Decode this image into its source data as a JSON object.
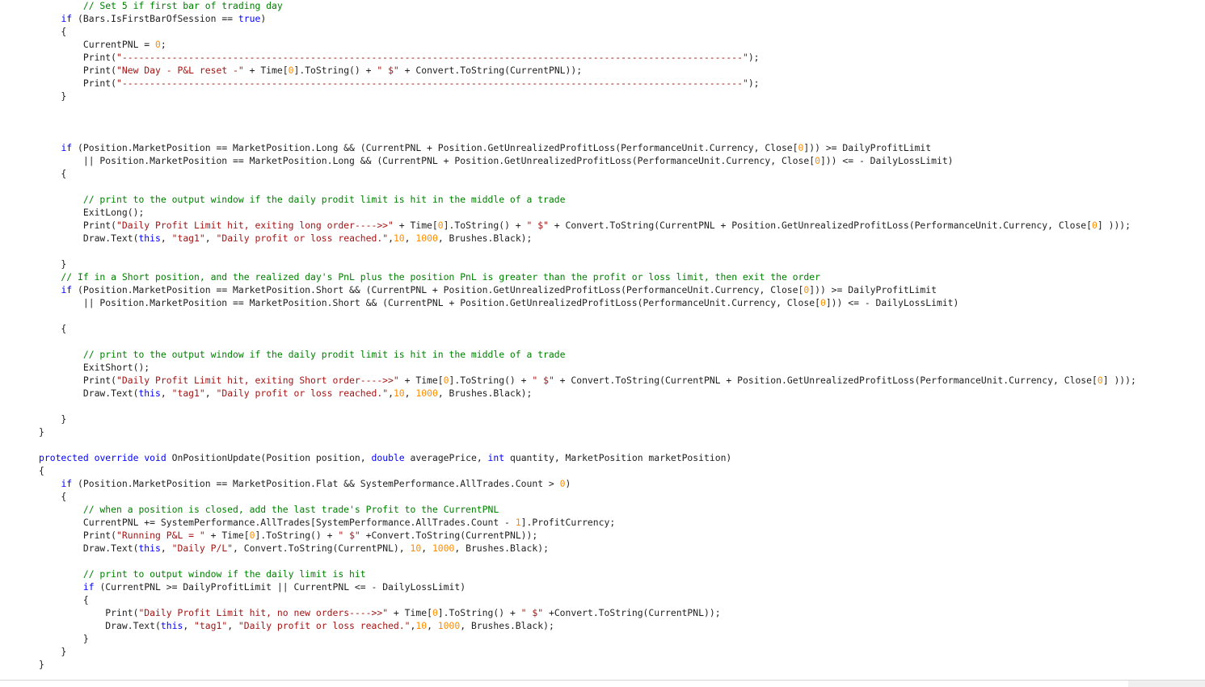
{
  "colors": {
    "background": "#ffffff",
    "text": "#1e1e1e",
    "keyword": "#0000ff",
    "string": "#a31515",
    "number": "#ff8c00",
    "comment": "#008000"
  },
  "lines": [
    [
      {
        "t": "com",
        "v": "        // Set 5 if first bar of trading day"
      }
    ],
    [
      {
        "t": "txt",
        "v": "    "
      },
      {
        "t": "kw",
        "v": "if"
      },
      {
        "t": "txt",
        "v": " (Bars.IsFirstBarOfSession == "
      },
      {
        "t": "kw",
        "v": "true"
      },
      {
        "t": "txt",
        "v": ")"
      }
    ],
    [
      {
        "t": "txt",
        "v": "    {"
      }
    ],
    [
      {
        "t": "txt",
        "v": "        CurrentPNL = "
      },
      {
        "t": "num",
        "v": "0"
      },
      {
        "t": "txt",
        "v": ";"
      }
    ],
    [
      {
        "t": "txt",
        "v": "        Print("
      },
      {
        "t": "str",
        "v": "\"----------------------------------------------------------------------------------------------------------------\""
      },
      {
        "t": "txt",
        "v": ");"
      }
    ],
    [
      {
        "t": "txt",
        "v": "        Print("
      },
      {
        "t": "str",
        "v": "\"New Day - P&L reset -\""
      },
      {
        "t": "txt",
        "v": " + Time["
      },
      {
        "t": "num",
        "v": "0"
      },
      {
        "t": "txt",
        "v": "].ToString() + "
      },
      {
        "t": "str",
        "v": "\" $\""
      },
      {
        "t": "txt",
        "v": " + Convert.ToString(CurrentPNL));"
      }
    ],
    [
      {
        "t": "txt",
        "v": "        Print("
      },
      {
        "t": "str",
        "v": "\"----------------------------------------------------------------------------------------------------------------\""
      },
      {
        "t": "txt",
        "v": ");"
      }
    ],
    [
      {
        "t": "txt",
        "v": "    }"
      }
    ],
    [],
    [],
    [],
    [
      {
        "t": "txt",
        "v": "    "
      },
      {
        "t": "kw",
        "v": "if"
      },
      {
        "t": "txt",
        "v": " (Position.MarketPosition == MarketPosition.Long && (CurrentPNL + Position.GetUnrealizedProfitLoss(PerformanceUnit.Currency, Close["
      },
      {
        "t": "num",
        "v": "0"
      },
      {
        "t": "txt",
        "v": "])) >= DailyProfitLimit"
      }
    ],
    [
      {
        "t": "txt",
        "v": "        || Position.MarketPosition == MarketPosition.Long && (CurrentPNL + Position.GetUnrealizedProfitLoss(PerformanceUnit.Currency, Close["
      },
      {
        "t": "num",
        "v": "0"
      },
      {
        "t": "txt",
        "v": "])) <= - DailyLossLimit)"
      }
    ],
    [
      {
        "t": "txt",
        "v": "    {"
      }
    ],
    [],
    [
      {
        "t": "com",
        "v": "        // print to the output window if the daily prodit limit is hit in the middle of a trade"
      }
    ],
    [
      {
        "t": "txt",
        "v": "        ExitLong();"
      }
    ],
    [
      {
        "t": "txt",
        "v": "        Print("
      },
      {
        "t": "str",
        "v": "\"Daily Profit Limit hit, exiting long order---->>\""
      },
      {
        "t": "txt",
        "v": " + Time["
      },
      {
        "t": "num",
        "v": "0"
      },
      {
        "t": "txt",
        "v": "].ToString() + "
      },
      {
        "t": "str",
        "v": "\" $\""
      },
      {
        "t": "txt",
        "v": " + Convert.ToString(CurrentPNL + Position.GetUnrealizedProfitLoss(PerformanceUnit.Currency, Close["
      },
      {
        "t": "num",
        "v": "0"
      },
      {
        "t": "txt",
        "v": "] )));"
      }
    ],
    [
      {
        "t": "txt",
        "v": "        Draw.Text("
      },
      {
        "t": "kw",
        "v": "this"
      },
      {
        "t": "txt",
        "v": ", "
      },
      {
        "t": "str",
        "v": "\"tag1\""
      },
      {
        "t": "txt",
        "v": ", "
      },
      {
        "t": "str",
        "v": "\"Daily profit or loss reached.\""
      },
      {
        "t": "txt",
        "v": ","
      },
      {
        "t": "num",
        "v": "10"
      },
      {
        "t": "txt",
        "v": ", "
      },
      {
        "t": "num",
        "v": "1000"
      },
      {
        "t": "txt",
        "v": ", Brushes.Black);"
      }
    ],
    [],
    [
      {
        "t": "txt",
        "v": "    }"
      }
    ],
    [
      {
        "t": "com",
        "v": "    // If in a Short position, and the realized day's PnL plus the position PnL is greater than the profit or loss limit, then exit the order"
      }
    ],
    [
      {
        "t": "txt",
        "v": "    "
      },
      {
        "t": "kw",
        "v": "if"
      },
      {
        "t": "txt",
        "v": " (Position.MarketPosition == MarketPosition.Short && (CurrentPNL + Position.GetUnrealizedProfitLoss(PerformanceUnit.Currency, Close["
      },
      {
        "t": "num",
        "v": "0"
      },
      {
        "t": "txt",
        "v": "])) >= DailyProfitLimit"
      }
    ],
    [
      {
        "t": "txt",
        "v": "        || Position.MarketPosition == MarketPosition.Short && (CurrentPNL + Position.GetUnrealizedProfitLoss(PerformanceUnit.Currency, Close["
      },
      {
        "t": "num",
        "v": "0"
      },
      {
        "t": "txt",
        "v": "])) <= - DailyLossLimit)"
      }
    ],
    [],
    [
      {
        "t": "txt",
        "v": "    {"
      }
    ],
    [],
    [
      {
        "t": "com",
        "v": "        // print to the output window if the daily prodit limit is hit in the middle of a trade"
      }
    ],
    [
      {
        "t": "txt",
        "v": "        ExitShort();"
      }
    ],
    [
      {
        "t": "txt",
        "v": "        Print("
      },
      {
        "t": "str",
        "v": "\"Daily Profit Limit hit, exiting Short order---->>\""
      },
      {
        "t": "txt",
        "v": " + Time["
      },
      {
        "t": "num",
        "v": "0"
      },
      {
        "t": "txt",
        "v": "].ToString() + "
      },
      {
        "t": "str",
        "v": "\" $\""
      },
      {
        "t": "txt",
        "v": " + Convert.ToString(CurrentPNL + Position.GetUnrealizedProfitLoss(PerformanceUnit.Currency, Close["
      },
      {
        "t": "num",
        "v": "0"
      },
      {
        "t": "txt",
        "v": "] )));"
      }
    ],
    [
      {
        "t": "txt",
        "v": "        Draw.Text("
      },
      {
        "t": "kw",
        "v": "this"
      },
      {
        "t": "txt",
        "v": ", "
      },
      {
        "t": "str",
        "v": "\"tag1\""
      },
      {
        "t": "txt",
        "v": ", "
      },
      {
        "t": "str",
        "v": "\"Daily profit or loss reached.\""
      },
      {
        "t": "txt",
        "v": ","
      },
      {
        "t": "num",
        "v": "10"
      },
      {
        "t": "txt",
        "v": ", "
      },
      {
        "t": "num",
        "v": "1000"
      },
      {
        "t": "txt",
        "v": ", Brushes.Black);"
      }
    ],
    [],
    [
      {
        "t": "txt",
        "v": "    }"
      }
    ],
    [
      {
        "t": "txt",
        "v": "}"
      }
    ],
    [],
    [
      {
        "t": "kw",
        "v": "protected"
      },
      {
        "t": "txt",
        "v": " "
      },
      {
        "t": "kw",
        "v": "override"
      },
      {
        "t": "txt",
        "v": " "
      },
      {
        "t": "kw",
        "v": "void"
      },
      {
        "t": "txt",
        "v": " OnPositionUpdate(Position position, "
      },
      {
        "t": "kw",
        "v": "double"
      },
      {
        "t": "txt",
        "v": " averagePrice, "
      },
      {
        "t": "kw",
        "v": "int"
      },
      {
        "t": "txt",
        "v": " quantity, MarketPosition marketPosition)"
      }
    ],
    [
      {
        "t": "txt",
        "v": "{"
      }
    ],
    [
      {
        "t": "txt",
        "v": "    "
      },
      {
        "t": "kw",
        "v": "if"
      },
      {
        "t": "txt",
        "v": " (Position.MarketPosition == MarketPosition.Flat && SystemPerformance.AllTrades.Count > "
      },
      {
        "t": "num",
        "v": "0"
      },
      {
        "t": "txt",
        "v": ")"
      }
    ],
    [
      {
        "t": "txt",
        "v": "    {"
      }
    ],
    [
      {
        "t": "com",
        "v": "        // when a position is closed, add the last trade's Profit to the CurrentPNL"
      }
    ],
    [
      {
        "t": "txt",
        "v": "        CurrentPNL += SystemPerformance.AllTrades[SystemPerformance.AllTrades.Count - "
      },
      {
        "t": "num",
        "v": "1"
      },
      {
        "t": "txt",
        "v": "].ProfitCurrency;"
      }
    ],
    [
      {
        "t": "txt",
        "v": "        Print("
      },
      {
        "t": "str",
        "v": "\"Running P&L = \""
      },
      {
        "t": "txt",
        "v": " + Time["
      },
      {
        "t": "num",
        "v": "0"
      },
      {
        "t": "txt",
        "v": "].ToString() + "
      },
      {
        "t": "str",
        "v": "\" $\""
      },
      {
        "t": "txt",
        "v": " +Convert.ToString(CurrentPNL));"
      }
    ],
    [
      {
        "t": "txt",
        "v": "        Draw.Text("
      },
      {
        "t": "kw",
        "v": "this"
      },
      {
        "t": "txt",
        "v": ", "
      },
      {
        "t": "str",
        "v": "\"Daily P/L\""
      },
      {
        "t": "txt",
        "v": ", Convert.ToString(CurrentPNL), "
      },
      {
        "t": "num",
        "v": "10"
      },
      {
        "t": "txt",
        "v": ", "
      },
      {
        "t": "num",
        "v": "1000"
      },
      {
        "t": "txt",
        "v": ", Brushes.Black);"
      }
    ],
    [],
    [
      {
        "t": "com",
        "v": "        // print to output window if the daily limit is hit"
      }
    ],
    [
      {
        "t": "txt",
        "v": "        "
      },
      {
        "t": "kw",
        "v": "if"
      },
      {
        "t": "txt",
        "v": " (CurrentPNL >= DailyProfitLimit || CurrentPNL <= - DailyLossLimit)"
      }
    ],
    [
      {
        "t": "txt",
        "v": "        {"
      }
    ],
    [
      {
        "t": "txt",
        "v": "            Print("
      },
      {
        "t": "str",
        "v": "\"Daily Profit Limit hit, no new orders---->>\""
      },
      {
        "t": "txt",
        "v": " + Time["
      },
      {
        "t": "num",
        "v": "0"
      },
      {
        "t": "txt",
        "v": "].ToString() + "
      },
      {
        "t": "str",
        "v": "\" $\""
      },
      {
        "t": "txt",
        "v": " +Convert.ToString(CurrentPNL));"
      }
    ],
    [
      {
        "t": "txt",
        "v": "            Draw.Text("
      },
      {
        "t": "kw",
        "v": "this"
      },
      {
        "t": "txt",
        "v": ", "
      },
      {
        "t": "str",
        "v": "\"tag1\""
      },
      {
        "t": "txt",
        "v": ", "
      },
      {
        "t": "str",
        "v": "\"Daily profit or loss reached.\""
      },
      {
        "t": "txt",
        "v": ","
      },
      {
        "t": "num",
        "v": "10"
      },
      {
        "t": "txt",
        "v": ", "
      },
      {
        "t": "num",
        "v": "1000"
      },
      {
        "t": "txt",
        "v": ", Brushes.Black);"
      }
    ],
    [
      {
        "t": "txt",
        "v": "        }"
      }
    ],
    [
      {
        "t": "txt",
        "v": "    }"
      }
    ],
    [
      {
        "t": "txt",
        "v": "}"
      }
    ]
  ]
}
